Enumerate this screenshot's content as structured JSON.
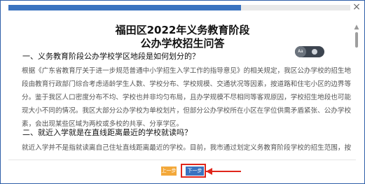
{
  "progress": {
    "fraction": 0.68
  },
  "close_icon": "×",
  "scroll_up_icon": "▲",
  "title": {
    "line1": "福田区2022年义务教育阶段",
    "line2": "公办学校招生问答"
  },
  "zoom": {
    "label": "Aa"
  },
  "sections": [
    {
      "heading": "一、义务教育阶段公办学校学区地段是如何划分的？",
      "lines": [
        "根据《广东省教育厅关于进一步规范普通中小学招生入学工作的指导意见》的相关规定，我区公办学校的招生地",
        "段由教育行政部门综合考虑适龄学生人数、学校分布、学校规模、交通状况等因素，按道路和住宅小区的边界等进行划",
        "分。鉴于我区人口密度分布不均、学校也并非均匀布局，且办学规模不尽相同等客观原因，学校招生地段也可能出",
        "现大小不同的情况。我区大部分公办学校为单校划片，但部分公办学校所在小区在学位供需矛盾紧张、公办学校布局不均等因",
        "素，会出现某些区域为两校或多校的共享、分享学区。"
      ]
    },
    {
      "heading": "二、就近入学就是在直线距离最近的学校就读吗？",
      "lines": [
        "就近入学并不是指就读离自己住址直线距离最近的学校。目前，我市通过划定义务教育阶段学校的招生范围，按"
      ]
    }
  ],
  "buttons": {
    "prev_label": "上一步",
    "next_label": "下一步"
  },
  "colors": {
    "accent": "#3a73c0",
    "prev": "#f3a83a",
    "annotation": "#e0261b"
  }
}
